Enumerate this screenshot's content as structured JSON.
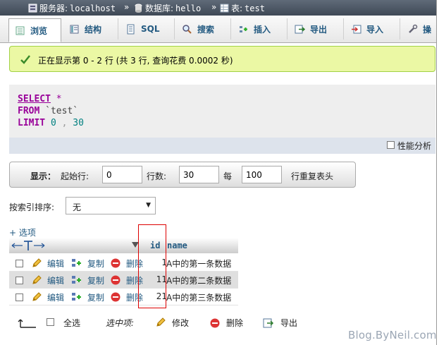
{
  "breadcrumb": {
    "server_label": "服务器:",
    "server_value": "localhost",
    "db_label": "数据库:",
    "db_value": "hello",
    "table_label": "表:",
    "table_value": "test",
    "separator": "»"
  },
  "tabs": [
    {
      "label": "浏览",
      "icon": "browse-icon"
    },
    {
      "label": "结构",
      "icon": "structure-icon"
    },
    {
      "label": "SQL",
      "icon": "sql-icon"
    },
    {
      "label": "搜索",
      "icon": "search-icon"
    },
    {
      "label": "插入",
      "icon": "insert-icon"
    },
    {
      "label": "导出",
      "icon": "export-icon"
    },
    {
      "label": "导入",
      "icon": "import-icon"
    },
    {
      "label": "操",
      "icon": "operations-icon"
    }
  ],
  "success_message": "正在显示第 0 - 2 行 (共 3 行, 查询花费 0.0002 秒)",
  "sql": {
    "select_kw": "SELECT",
    "star": "*",
    "from_kw": "FROM",
    "table": "`test`",
    "limit_kw": "LIMIT",
    "limit_offset": "0",
    "comma": ",",
    "limit_count": "30"
  },
  "profiling_label": "性能分析",
  "nav": {
    "display_label": "显示：",
    "start_label": "起始行:",
    "start_value": "0",
    "rows_label": "行数:",
    "rows_value": "30",
    "every_label": "每",
    "repeat_value": "100",
    "repeat_label": "行重复表头"
  },
  "sort": {
    "label": "按索引排序:",
    "value": "无"
  },
  "options_label": "+ 选项",
  "columns": {
    "id": "id",
    "name": "name"
  },
  "actions": {
    "edit": "编辑",
    "copy": "复制",
    "delete": "删除"
  },
  "rows": [
    {
      "id": "1",
      "name": "A中的第一条数据"
    },
    {
      "id": "11",
      "name": "A中的第二条数据"
    },
    {
      "id": "21",
      "name": "A中的第三条数据"
    }
  ],
  "footer": {
    "check_all": "全选",
    "with_selected": "选中项:",
    "edit": "修改",
    "delete": "删除",
    "export": "导出"
  },
  "watermark": "Blog.ByNeil.com",
  "colors": {
    "link": "#235a81",
    "keyword": "#990099",
    "success_bg": "#ebf8a4",
    "highlight_box": "#dd0000"
  }
}
